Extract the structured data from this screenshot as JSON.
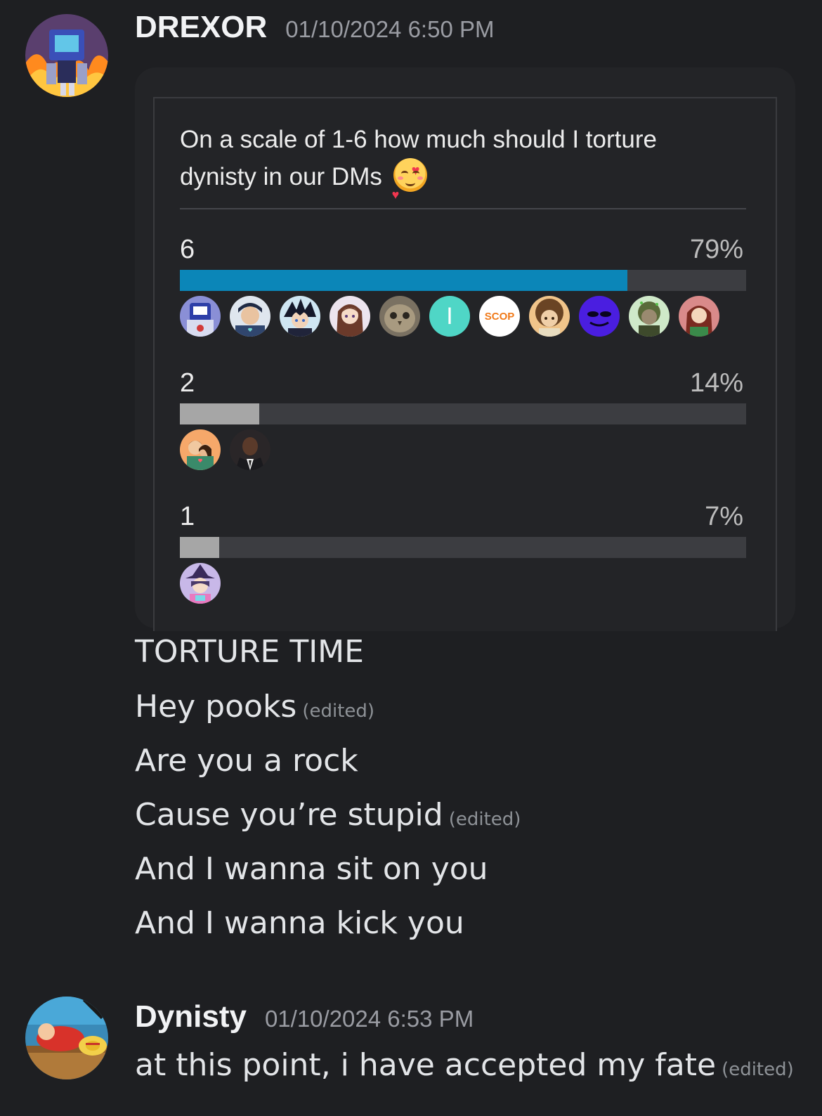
{
  "messages": [
    {
      "username": "DREXOR",
      "timestamp": "01/10/2024 6:50 PM",
      "avatar_icon": "robot-avatar",
      "poll": {
        "question": "On a scale of 1-6 how much should I torture dynisty in our DMs",
        "question_emoji": "smiling-face-with-hearts",
        "options": [
          {
            "label": "6",
            "percent_text": "79%",
            "percent": 79,
            "bar_color": "#0b86b8",
            "voters": 11
          },
          {
            "label": "2",
            "percent_text": "14%",
            "percent": 14,
            "bar_color": "#a6a6a6",
            "voters": 2
          },
          {
            "label": "1",
            "percent_text": "7%",
            "percent": 7,
            "bar_color": "#a6a6a6",
            "voters": 1
          }
        ],
        "voter_icons": {
          "option_6": [
            "robot-voter",
            "boy-heart-voter",
            "anime-dark-voter",
            "anime-girl-voter",
            "owl-photo-voter",
            "letter-i-voter",
            "scop-voter",
            "curly-hair-voter",
            "purple-alien-voter",
            "green-hair-voter",
            "red-hair-voter"
          ],
          "option_2": [
            "hugging-couple-voter",
            "man-suit-voter"
          ],
          "option_1": [
            "witch-girl-voter"
          ]
        },
        "voter_letters": {
          "letter_i": "I",
          "scop": "SCOP"
        }
      },
      "lines": [
        {
          "text": "TORTURE TIME",
          "edited": ""
        },
        {
          "text": "Hey pooks",
          "edited": "(edited)"
        },
        {
          "text": "Are you a rock",
          "edited": ""
        },
        {
          "text": "Cause you’re stupid",
          "edited": "(edited)"
        },
        {
          "text": "And I wanna sit on you",
          "edited": ""
        },
        {
          "text": "And I wanna kick you",
          "edited": ""
        }
      ]
    },
    {
      "username": "Dynisty",
      "timestamp": "01/10/2024 6:53 PM",
      "avatar_icon": "straw-hat-avatar",
      "lines": [
        {
          "text": "at this point, i have accepted my fate",
          "edited": "(edited)"
        }
      ]
    }
  ]
}
